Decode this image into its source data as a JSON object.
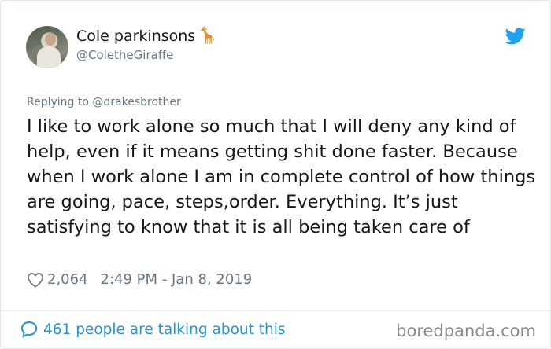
{
  "tweet": {
    "author_name": "Cole parkinsons",
    "author_emoji": "🦒",
    "handle": "@ColetheGiraffe",
    "replying_to": "Replying to @drakesbrother",
    "text": "I like to work alone so much that I will deny any kind of help, even if it means getting shit done faster. Because when I work alone I am in complete control of how things are going, pace, steps,order. Everything. It’s just satisfying  to know that it is all being taken care of",
    "likes": "2,064",
    "timestamp": "2:49 PM - Jan 8, 2019",
    "conversation": "461 people are talking about this"
  },
  "watermark": "boredpanda.com",
  "icons": {
    "brand": "twitter-bird-icon",
    "like": "heart-icon",
    "conversation": "speech-bubble-icon"
  },
  "colors": {
    "twitter_blue": "#1da1f2",
    "link_blue": "#1b95e0",
    "muted_gray": "#657786",
    "text": "#14171a",
    "border": "#e1e8ed"
  }
}
